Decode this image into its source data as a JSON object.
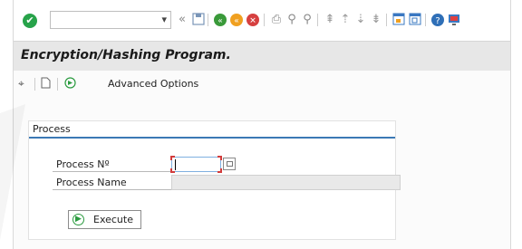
{
  "toolbar": {
    "command_value": "",
    "icons": [
      "check-icon",
      "dropdown-icon",
      "back-chevrons-icon",
      "save-icon",
      "back-icon",
      "exit-icon",
      "cancel-icon",
      "print-icon",
      "find-icon",
      "find-next-icon",
      "first-page-icon",
      "previous-page-icon",
      "next-page-icon",
      "last-page-icon",
      "new-session-icon",
      "shortcut-icon",
      "help-icon",
      "customize-layout-icon"
    ]
  },
  "title": "Encryption/Hashing Program.",
  "app_toolbar": {
    "advanced_label": "Advanced Options"
  },
  "group": {
    "title": "Process",
    "fields": [
      {
        "label": "Process Nº",
        "value": ""
      },
      {
        "label": "Process Name",
        "value": ""
      }
    ],
    "execute_label": "Execute"
  },
  "colors": {
    "accent": "#3b79b5",
    "title_bar": "#e7e7e7",
    "check_green": "#27a34a"
  }
}
